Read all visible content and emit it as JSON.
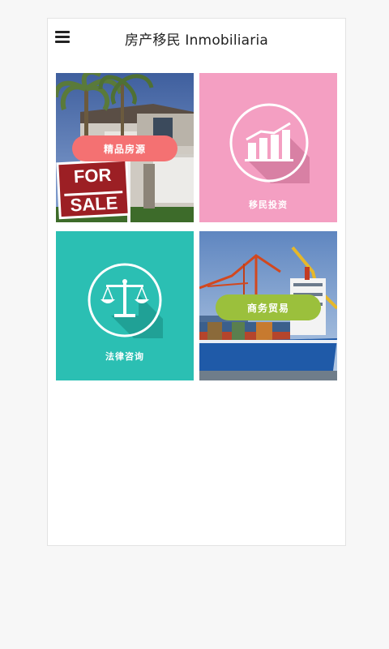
{
  "header": {
    "title": "房产移民 Inmobiliaria"
  },
  "tiles": [
    {
      "label": "精品房源",
      "sign_line1": "FOR",
      "sign_line2": "SALE",
      "accent": "#f47172"
    },
    {
      "label": "移民投资",
      "bg": "#f49fc2"
    },
    {
      "label": "法律咨询",
      "bg": "#2bbfb3"
    },
    {
      "label": "商务贸易",
      "accent": "#9bc03c"
    }
  ],
  "icons": {
    "menu": "hamburger-icon",
    "investment": "bar-chart-icon",
    "law": "scales-icon"
  }
}
